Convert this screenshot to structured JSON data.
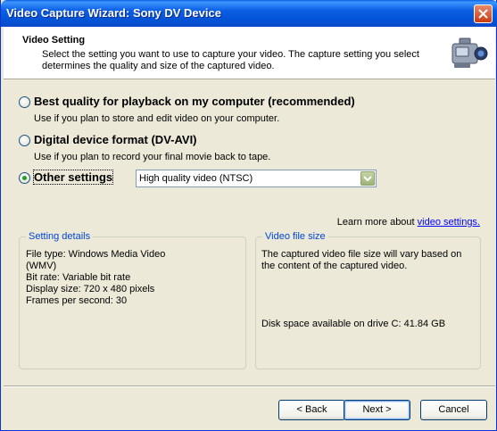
{
  "window": {
    "title": "Video Capture Wizard: Sony DV Device"
  },
  "header": {
    "title": "Video Setting",
    "description": "Select the setting you want to use to capture your video. The capture setting you select determines the quality and size of the captured video."
  },
  "options": [
    {
      "label": "Best quality for playback on my computer (recommended)",
      "description": "Use if you plan to store and edit video on your computer.",
      "selected": false
    },
    {
      "label": "Digital device format (DV-AVI)",
      "description": "Use if you plan to record your final movie back to tape.",
      "selected": false
    },
    {
      "label": "Other settings",
      "selected": true
    }
  ],
  "other_settings_select": {
    "value": "High quality video (NTSC)"
  },
  "learn_more": {
    "text": "Learn more about",
    "link": "video settings."
  },
  "setting_details": {
    "legend": "Setting details",
    "lines": [
      "File type: Windows Media Video",
      "(WMV)",
      "Bit rate: Variable bit rate",
      "Display size: 720 x 480 pixels",
      "Frames per second: 30"
    ]
  },
  "video_file_size": {
    "legend": "Video file size",
    "lines": [
      "The captured video file size will vary based on",
      "the content of the captured video."
    ],
    "disk_space": "Disk space available on drive C: 41.84 GB"
  },
  "buttons": {
    "back": "< Back",
    "next": "Next >",
    "cancel": "Cancel"
  },
  "colors": {
    "titlebar": "#0454d8",
    "dialog": "#ece9d8",
    "link": "#0000ff",
    "legend": "#0046d5"
  }
}
